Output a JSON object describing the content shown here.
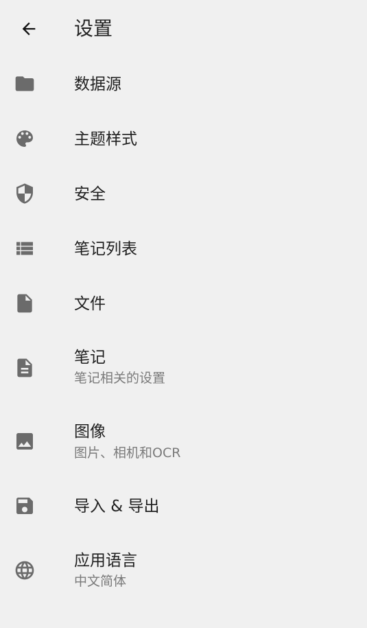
{
  "header": {
    "title": "设置",
    "back_icon": "arrow-back-icon"
  },
  "colors": {
    "background": "#f0f0f0",
    "icon": "#6b6b6b",
    "title": "#222222",
    "subtitle": "#7a7a7a"
  },
  "items": [
    {
      "label": "数据源",
      "icon": "folder-icon"
    },
    {
      "label": "主题样式",
      "icon": "palette-icon"
    },
    {
      "label": "安全",
      "icon": "shield-icon"
    },
    {
      "label": "笔记列表",
      "icon": "list-icon"
    },
    {
      "label": "文件",
      "icon": "file-icon"
    },
    {
      "label": "笔记",
      "subtitle": "笔记相关的设置",
      "icon": "note-icon"
    },
    {
      "label": "图像",
      "subtitle": "图片、相机和OCR",
      "icon": "image-icon"
    },
    {
      "label": "导入 & 导出",
      "icon": "save-icon"
    },
    {
      "label": "应用语言",
      "subtitle": "中文简体",
      "icon": "globe-icon"
    }
  ]
}
